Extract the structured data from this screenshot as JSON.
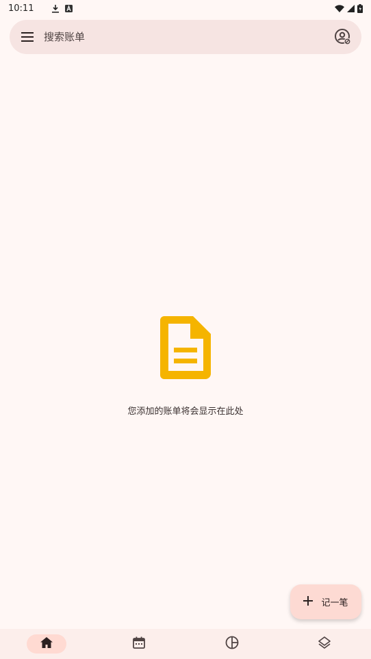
{
  "status_bar": {
    "time": "10:11",
    "icons": [
      "download-icon",
      "a-badge-icon",
      "wifi-icon",
      "signal-icon",
      "battery-icon"
    ]
  },
  "search": {
    "placeholder": "搜索账单",
    "leading_icon": "menu-icon",
    "trailing_icon": "account-icon"
  },
  "empty_state": {
    "icon": "document-icon",
    "icon_color": "#F5B400",
    "message": "您添加的账单将会显示在此处"
  },
  "fab": {
    "icon": "plus-icon",
    "label": "记一笔"
  },
  "bottom_nav": {
    "items": [
      {
        "icon": "home-icon",
        "active": true
      },
      {
        "icon": "calendar-icon",
        "active": false
      },
      {
        "icon": "pie-chart-icon",
        "active": false
      },
      {
        "icon": "layers-icon",
        "active": false
      }
    ]
  },
  "colors": {
    "background": "#FFF7F5",
    "search_bar": "#F6E4E2",
    "fab": "#FDDAD3",
    "nav_background": "#FCEEEB",
    "nav_active_pill": "#FFDAD2",
    "accent_icon": "#F5B400"
  }
}
